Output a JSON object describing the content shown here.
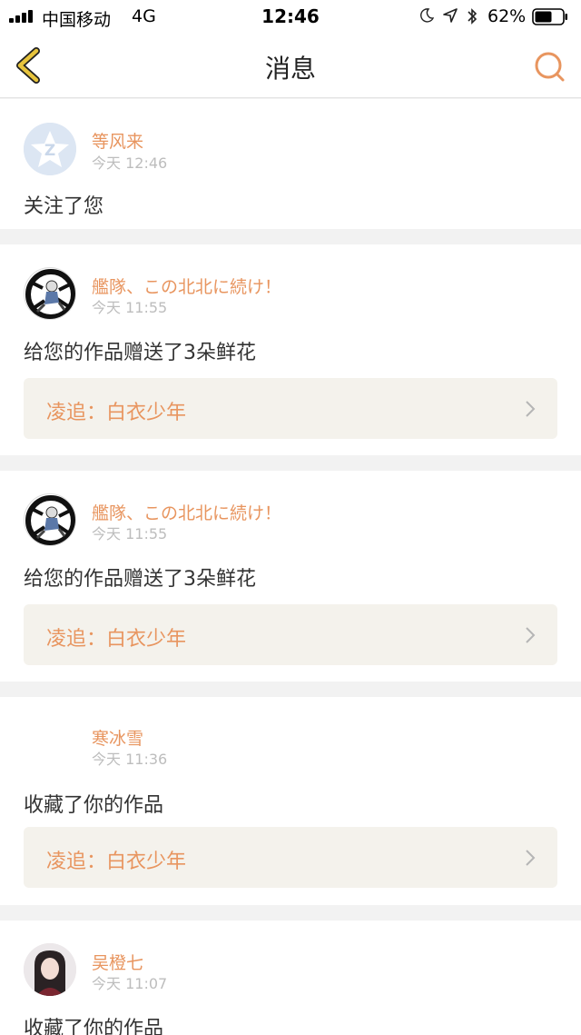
{
  "status_bar": {
    "carrier": "中国移动",
    "network": "4G",
    "time": "12:46",
    "battery_percent": "62%",
    "battery_level": 0.62,
    "icons": [
      "signal-icon",
      "moon-icon",
      "location-arrow-icon",
      "bluetooth-icon",
      "battery-icon"
    ]
  },
  "nav": {
    "title": "消息",
    "back_icon": "chevron-left-icon",
    "search_icon": "search-icon"
  },
  "colors": {
    "accent": "#e8955f",
    "back_arrow": "#e7c43d",
    "work_box_bg": "#f4f2ec"
  },
  "messages": [
    {
      "user": "等风来",
      "time": "今天 12:46",
      "action": "关注了您",
      "avatar": "default-qzone-avatar"
    },
    {
      "user": "艦隊、この北北に続け！",
      "time": "今天 11:55",
      "action": "给您的作品赠送了3朵鲜花",
      "avatar": "anime-avatar",
      "work": "凌追：白衣少年"
    },
    {
      "user": "艦隊、この北北に続け！",
      "time": "今天 11:55",
      "action": "给您的作品赠送了3朵鲜花",
      "avatar": "anime-avatar",
      "work": "凌追：白衣少年"
    },
    {
      "user": "寒冰雪",
      "time": "今天 11:36",
      "action": "收藏了你的作品",
      "avatar": "blank-avatar",
      "work": "凌追：白衣少年"
    },
    {
      "user": "吴橙七",
      "time": "今天 11:07",
      "action": "收藏了你的作品",
      "avatar": "girl-photo-avatar"
    }
  ]
}
